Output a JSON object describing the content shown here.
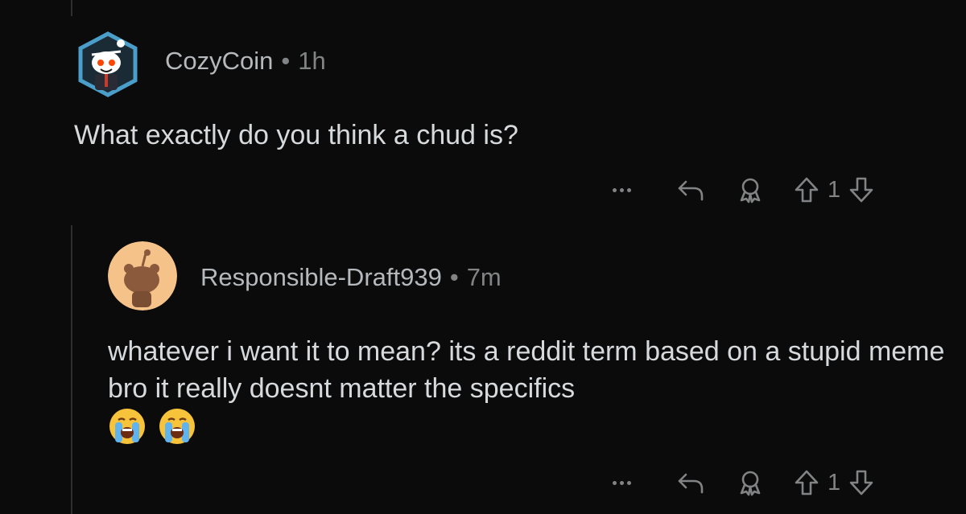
{
  "comments": [
    {
      "username": "CozyCoin",
      "separator": "•",
      "age": "1h",
      "body": "What exactly do you think a chud is?",
      "score": "1"
    },
    {
      "username": "Responsible-Draft939",
      "separator": "•",
      "age": "7m",
      "body": "whatever i want it to mean? its a reddit term based on a stupid meme bro it really doesnt matter the specifics",
      "emojis": [
        "loudly-crying-face",
        "loudly-crying-face"
      ],
      "score": "1"
    }
  ],
  "icons": {
    "more": "more-options-icon",
    "reply": "reply-icon",
    "award": "award-icon",
    "upvote": "upvote-icon",
    "downvote": "downvote-icon"
  },
  "colors": {
    "background": "#0b0b0c",
    "text": "#d7dadc",
    "muted": "#818384",
    "avatar1_border": "#4a9ec9",
    "avatar2_bg": "#f5c28a"
  }
}
